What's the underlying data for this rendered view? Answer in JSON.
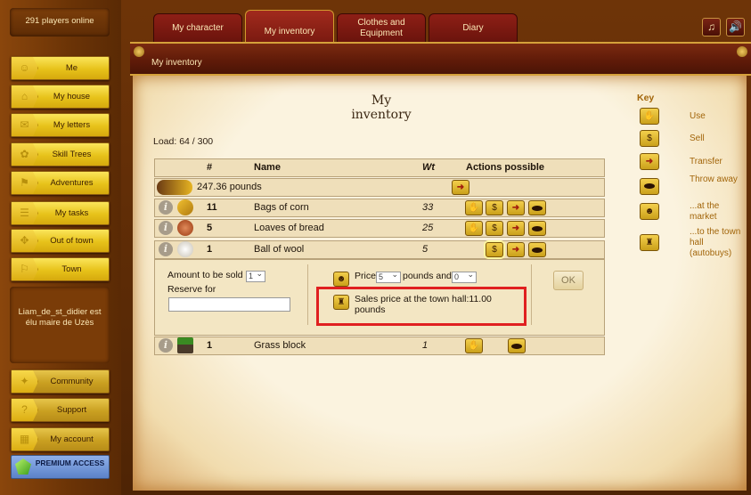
{
  "online": "291 players online",
  "sidebar": {
    "items": [
      {
        "label": "Me",
        "icon": "person-icon"
      },
      {
        "label": "My house",
        "icon": "house-icon"
      },
      {
        "label": "My letters",
        "icon": "envelope-icon"
      },
      {
        "label": "Skill Trees",
        "icon": "skill-tree-icon"
      },
      {
        "label": "Adventures",
        "icon": "map-icon"
      },
      {
        "label": "My tasks",
        "icon": "scroll-icon"
      },
      {
        "label": "Out of town",
        "icon": "compass-icon"
      },
      {
        "label": "Town",
        "icon": "flag-icon"
      }
    ],
    "news": "Liam_de_st_didier est élu maire de Uzès",
    "bottom": [
      {
        "label": "Community",
        "icon": "community-icon"
      },
      {
        "label": "Support",
        "icon": "question-icon"
      },
      {
        "label": "My account",
        "icon": "account-icon"
      }
    ],
    "premium": "PREMIUM ACCESS"
  },
  "tabs": [
    {
      "label": "My character",
      "active": false
    },
    {
      "label": "My inventory",
      "active": true
    },
    {
      "label": "Clothes and Equipment",
      "active": false
    },
    {
      "label": "Diary",
      "active": false
    }
  ],
  "breadcrumb": "My inventory",
  "page_title": "My inventory",
  "load": "Load: 64 / 300",
  "table": {
    "headers": {
      "num": "#",
      "name": "Name",
      "wt": "Wt",
      "actions": "Actions possible"
    },
    "money": "247.36 pounds",
    "rows": [
      {
        "qty": "11",
        "name": "Bags of corn",
        "wt": "33"
      },
      {
        "qty": "5",
        "name": "Loaves of bread",
        "wt": "25"
      },
      {
        "qty": "1",
        "name": "Ball of wool",
        "wt": "5"
      },
      {
        "qty": "1",
        "name": "Grass block",
        "wt": "1"
      }
    ]
  },
  "sell_panel": {
    "amount_label": "Amount to be sold",
    "amount_value": "1",
    "reserve_label": "Reserve for",
    "price_label": "Price",
    "price_pounds": "5",
    "pounds_and": "pounds and",
    "price_pence": "0",
    "hall_price": "Sales price at the town hall:11.00 pounds",
    "ok": "OK"
  },
  "key": {
    "title": "Key",
    "items": [
      "Use",
      "Sell",
      "Transfer",
      "Throw away",
      "...at the market",
      "...to the town hall (autobuys)"
    ]
  },
  "colors": {
    "accent_red": "#e02020",
    "key_text": "#a2650a",
    "button_gold": "#e7c21a"
  }
}
